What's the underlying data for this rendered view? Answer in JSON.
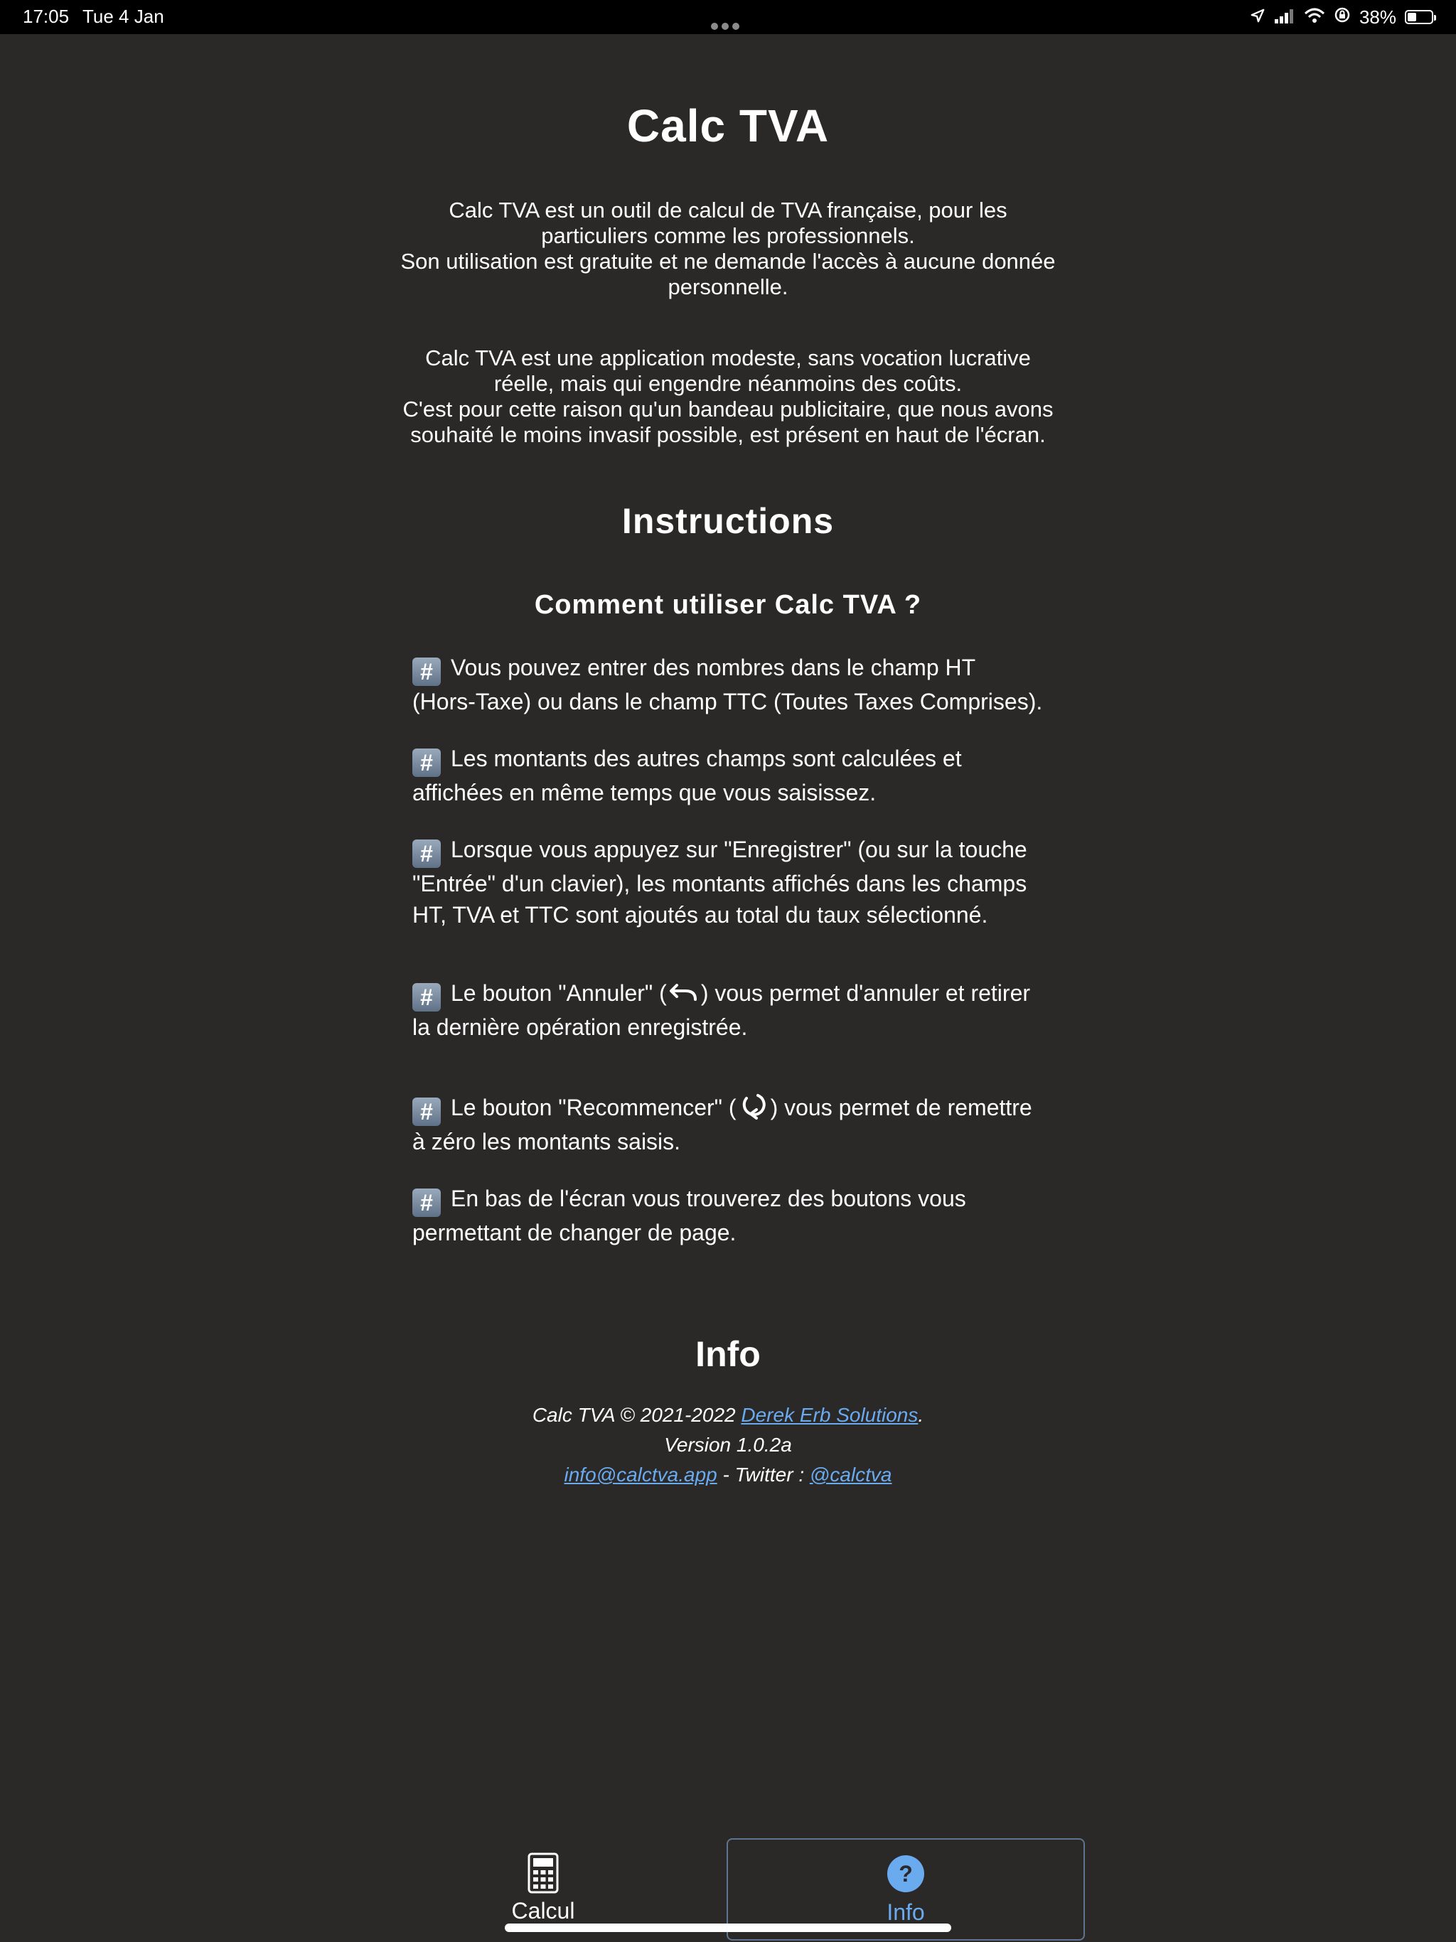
{
  "status_bar": {
    "time": "17:05",
    "date": "Tue 4 Jan",
    "battery_percent": "38%",
    "battery_level": 0.38,
    "icons": [
      "location-icon",
      "cellular-signal-icon",
      "wifi-icon",
      "rotation-lock-icon",
      "battery-icon"
    ]
  },
  "header": {
    "title": "Calc TVA"
  },
  "intro": {
    "p1_line1": "Calc TVA est un outil de calcul de TVA française, pour les particuliers comme les professionnels.",
    "p1_line2": "Son utilisation est gratuite et ne demande l'accès à aucune donnée personnelle.",
    "p2_line1": "Calc TVA est une application modeste, sans vocation lucrative réelle, mais qui engendre néanmoins des coûts.",
    "p2_line2": "C'est pour cette raison qu'un bandeau publicitaire, que nous avons souhaité le moins invasif possible, est présent en haut de l'écran."
  },
  "instructions": {
    "title": "Instructions",
    "subtitle": "Comment utiliser Calc TVA ?",
    "items": [
      {
        "text": "Vous pouvez entrer des nombres dans le champ HT (Hors-Taxe) ou dans le champ TTC (Toutes Taxes Comprises)."
      },
      {
        "text": "Les montants des autres champs sont calculées et affichées en même temps que vous saisissez."
      },
      {
        "text": "Lorsque vous appuyez sur \"Enregistrer\" (ou sur la touche \"Entrée\" d'un clavier), les montants affichés dans les champs HT, TVA et TTC sont ajoutés au total du taux sélectionné."
      },
      {
        "before": "Le bouton \"Annuler\" (",
        "after": ") vous permet d'annuler et retirer la dernière opération enregistrée."
      },
      {
        "before": "Le bouton \"Recommencer\" (",
        "after": ") vous permet de remettre à zéro les montants saisis."
      },
      {
        "text": "En bas de l'écran vous trouverez des boutons vous permettant de changer de page."
      }
    ],
    "bullet_icon": "#"
  },
  "info": {
    "title": "Info",
    "copyright_prefix": "Calc TVA © 2021-2022 ",
    "company_link": "Derek Erb Solutions",
    "copyright_suffix": ".",
    "version": "Version 1.0.2a",
    "email_link": "info@calctva.app",
    "twitter_prefix": " - Twitter : ",
    "twitter_link": "@calctva"
  },
  "tabbar": {
    "tabs": [
      {
        "label": "Calcul",
        "icon": "calculator-icon",
        "active": false
      },
      {
        "label": "Info",
        "icon": "help-circle-icon",
        "active": true
      }
    ]
  },
  "colors": {
    "background": "#2b2828",
    "accent": "#6aabf0",
    "active_tab_border": "#5d7590"
  }
}
